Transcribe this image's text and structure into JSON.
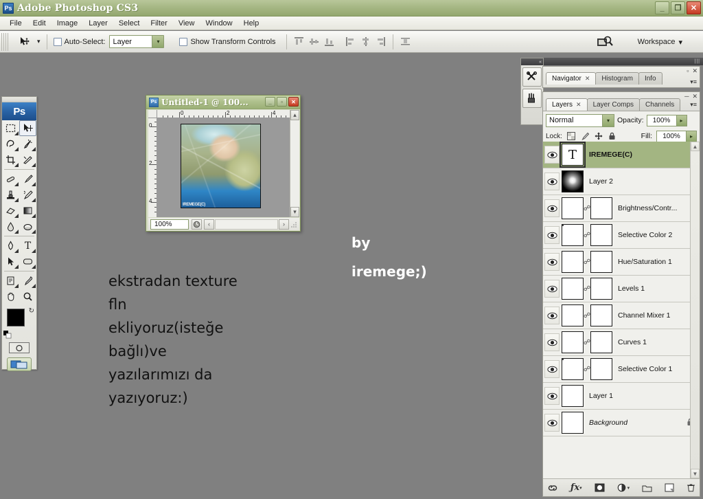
{
  "app": {
    "title": "Adobe Photoshop CS3",
    "icon": "Ps",
    "window_buttons": [
      {
        "name": "minimize-button",
        "glyph": "_"
      },
      {
        "name": "maximize-button",
        "glyph": "❐"
      },
      {
        "name": "close-button",
        "glyph": "✕"
      }
    ]
  },
  "menubar": {
    "items": [
      "File",
      "Edit",
      "Image",
      "Layer",
      "Select",
      "Filter",
      "View",
      "Window",
      "Help"
    ]
  },
  "options_bar": {
    "tool_icon": "move-tool-icon",
    "tool_preset_arrow": "▾",
    "auto_select_label": "Auto-Select:",
    "auto_select_value": "Layer",
    "auto_select_arrow": "▾",
    "show_transform_label": "Show Transform Controls",
    "align_group_1": [
      "align-top-edges-icon",
      "align-vertical-centers-icon",
      "align-bottom-edges-icon"
    ],
    "align_group_2": [
      "align-left-edges-icon",
      "align-horizontal-centers-icon",
      "align-right-edges-icon"
    ],
    "distribute_group": [
      "distribute-top-icon",
      "distribute-vertical-center-icon",
      "distribute-bottom-icon"
    ],
    "distribute_group_2": [
      "distribute-left-icon",
      "distribute-horizontal-center-icon",
      "distribute-right-icon"
    ],
    "auto_align_icon": "auto-align-layers-icon",
    "bridge_icon": "go-to-bridge-icon",
    "workspace_label": "Workspace",
    "workspace_arrow": "▾"
  },
  "toolbox": {
    "logo": "Ps",
    "tools": [
      [
        {
          "name": "rectangular-marquee-tool",
          "glyph": "⬚",
          "selected": false,
          "menu": false
        },
        {
          "name": "move-tool",
          "glyph": "↖",
          "selected": true,
          "menu": false
        }
      ],
      [
        {
          "name": "lasso-tool",
          "glyph": "⌇",
          "selected": false,
          "menu": true
        },
        {
          "name": "magic-wand-tool",
          "glyph": "✦",
          "selected": false,
          "menu": true
        }
      ],
      [
        {
          "name": "crop-tool",
          "glyph": "⌑",
          "selected": false,
          "menu": true
        },
        {
          "name": "slice-tool",
          "glyph": "✂",
          "selected": false,
          "menu": true
        }
      ],
      [
        {
          "name": "healing-brush-tool",
          "glyph": "✐",
          "selected": false,
          "menu": true
        },
        {
          "name": "brush-tool",
          "glyph": "✒",
          "selected": false,
          "menu": true
        }
      ],
      [
        {
          "name": "clone-stamp-tool",
          "glyph": "⚑",
          "selected": false,
          "menu": true
        },
        {
          "name": "history-brush-tool",
          "glyph": "✎",
          "selected": false,
          "menu": true
        }
      ],
      [
        {
          "name": "eraser-tool",
          "glyph": "▱",
          "selected": false,
          "menu": true
        },
        {
          "name": "gradient-tool",
          "glyph": "▤",
          "selected": false,
          "menu": true
        }
      ],
      [
        {
          "name": "blur-tool",
          "glyph": "●",
          "selected": false,
          "menu": true
        },
        {
          "name": "dodge-tool",
          "glyph": "◑",
          "selected": false,
          "menu": true
        }
      ],
      [
        {
          "name": "pen-tool",
          "glyph": "✑",
          "selected": false,
          "menu": true
        },
        {
          "name": "horizontal-type-tool",
          "glyph": "T",
          "selected": false,
          "menu": true
        }
      ],
      [
        {
          "name": "path-selection-tool",
          "glyph": "➤",
          "selected": false,
          "menu": true
        },
        {
          "name": "rounded-rectangle-tool",
          "glyph": "▭",
          "selected": false,
          "menu": true
        }
      ],
      [
        {
          "name": "notes-tool",
          "glyph": "☷",
          "selected": false,
          "menu": true
        },
        {
          "name": "eyedropper-tool",
          "glyph": "⚗",
          "selected": false,
          "menu": true
        }
      ],
      [
        {
          "name": "hand-tool",
          "glyph": "✋",
          "selected": false,
          "menu": false
        },
        {
          "name": "zoom-tool",
          "glyph": "⌕",
          "selected": false,
          "menu": false
        }
      ]
    ],
    "foreground_color": "#000000",
    "background_color": "#ffffff",
    "swap_icon": "swap-colors-icon",
    "default_colors_icon": "default-colors-icon",
    "quick_mask_icon": "quick-mask-mode-icon",
    "screen_mode_icon": "screen-mode-icon"
  },
  "document": {
    "title": "Untitled-1 @ 100...",
    "icon": "Ps",
    "zoom": "100%",
    "signature": "IREMEGE(C)",
    "ruler_marks": [
      "0",
      "2",
      "4"
    ],
    "ruler_marks_left": [
      "0",
      "2",
      "4"
    ],
    "buttons": [
      {
        "name": "doc-minimize-button",
        "glyph": "_"
      },
      {
        "name": "doc-maximize-button",
        "glyph": "▫"
      },
      {
        "name": "doc-close-button",
        "glyph": "✕"
      }
    ],
    "scroll_left_glyph": "‹",
    "scroll_right_glyph": "›",
    "scroll_up_glyph": "▴",
    "scroll_down_glyph": "▾",
    "doc-size-icon": "document-info-icon"
  },
  "dock": {
    "icons": [
      {
        "name": "tool-presets-icon",
        "glyph": "⚒"
      },
      {
        "name": "brushes-icon",
        "glyph": "⚘"
      }
    ],
    "collapse_glyph": "«"
  },
  "navigator_palette": {
    "tabs": [
      {
        "label": "Navigator",
        "active": true,
        "closable": true
      },
      {
        "label": "Histogram",
        "active": false,
        "closable": false
      },
      {
        "label": "Info",
        "active": false,
        "closable": false
      }
    ],
    "minimize_glyph": "▫",
    "close_glyph": "✕",
    "menu_glyph": "▾≡"
  },
  "layers_palette": {
    "tabs": [
      {
        "label": "Layers",
        "active": true,
        "closable": true
      },
      {
        "label": "Layer Comps",
        "active": false,
        "closable": false
      },
      {
        "label": "Channels",
        "active": false,
        "closable": false
      }
    ],
    "minimize_glyph": "─",
    "close_glyph": "✕",
    "menu_glyph": "▾≡",
    "blend_mode": "Normal",
    "blend_arrow": "▾",
    "opacity_label": "Opacity:",
    "opacity_value": "100%",
    "lock_label": "Lock:",
    "lock_icons": [
      {
        "name": "lock-transparent-pixels-icon",
        "glyph": "⬚"
      },
      {
        "name": "lock-image-pixels-icon",
        "glyph": "✐"
      },
      {
        "name": "lock-position-icon",
        "glyph": "✚"
      },
      {
        "name": "lock-all-icon",
        "glyph": "🔒"
      }
    ],
    "fill_label": "Fill:",
    "fill_value": "100%",
    "spinner_arrow": "▸",
    "layers": [
      {
        "name": "IREMEGE(C)",
        "type": "text",
        "selected": true,
        "bold": true,
        "italic": false,
        "mask": false,
        "thumb": "T",
        "locked": false
      },
      {
        "name": "Layer 2",
        "type": "raster",
        "selected": false,
        "bold": false,
        "italic": false,
        "mask": false,
        "thumb": "glow",
        "locked": false
      },
      {
        "name": "Brightness/Contr...",
        "type": "adjustment",
        "selected": false,
        "bold": false,
        "italic": false,
        "mask": true,
        "thumb": "brightness",
        "locked": false
      },
      {
        "name": "Selective Color 2",
        "type": "adjustment",
        "selected": false,
        "bold": false,
        "italic": false,
        "mask": true,
        "thumb": "selective",
        "locked": false
      },
      {
        "name": "Hue/Saturation 1",
        "type": "adjustment",
        "selected": false,
        "bold": false,
        "italic": false,
        "mask": true,
        "thumb": "huesat",
        "locked": false
      },
      {
        "name": "Levels 1",
        "type": "adjustment",
        "selected": false,
        "bold": false,
        "italic": false,
        "mask": true,
        "thumb": "levels",
        "locked": false
      },
      {
        "name": "Channel Mixer 1",
        "type": "adjustment",
        "selected": false,
        "bold": false,
        "italic": false,
        "mask": true,
        "thumb": "mixer",
        "locked": false
      },
      {
        "name": "Curves 1",
        "type": "adjustment",
        "selected": false,
        "bold": false,
        "italic": false,
        "mask": true,
        "thumb": "curves",
        "locked": false
      },
      {
        "name": "Selective Color 1",
        "type": "adjustment",
        "selected": false,
        "bold": false,
        "italic": false,
        "mask": true,
        "thumb": "selective",
        "locked": false
      },
      {
        "name": "Layer 1",
        "type": "raster",
        "selected": false,
        "bold": false,
        "italic": false,
        "mask": false,
        "thumb": "photo",
        "locked": false
      },
      {
        "name": "Background",
        "type": "background",
        "selected": false,
        "bold": false,
        "italic": true,
        "mask": false,
        "thumb": "white",
        "locked": true
      }
    ],
    "footer_buttons": [
      {
        "name": "link-layers-button",
        "glyph": "⚭"
      },
      {
        "name": "layer-style-button",
        "glyph": "ƒx"
      },
      {
        "name": "add-layer-mask-button",
        "glyph": "▣"
      },
      {
        "name": "new-adjustment-layer-button",
        "glyph": "◑"
      },
      {
        "name": "new-group-button",
        "glyph": "▱"
      },
      {
        "name": "new-layer-button",
        "glyph": "❐"
      },
      {
        "name": "delete-layer-button",
        "glyph": "🗑"
      }
    ]
  },
  "canvas": {
    "background_color": "#808080",
    "text_block_1": "ekstradan texture\nfln\nekliyoruz(isteğe\nbağlı)ve\nyazılarımızı da\nyazıyoruz:)",
    "text_block_2": "by\niremege;)"
  }
}
